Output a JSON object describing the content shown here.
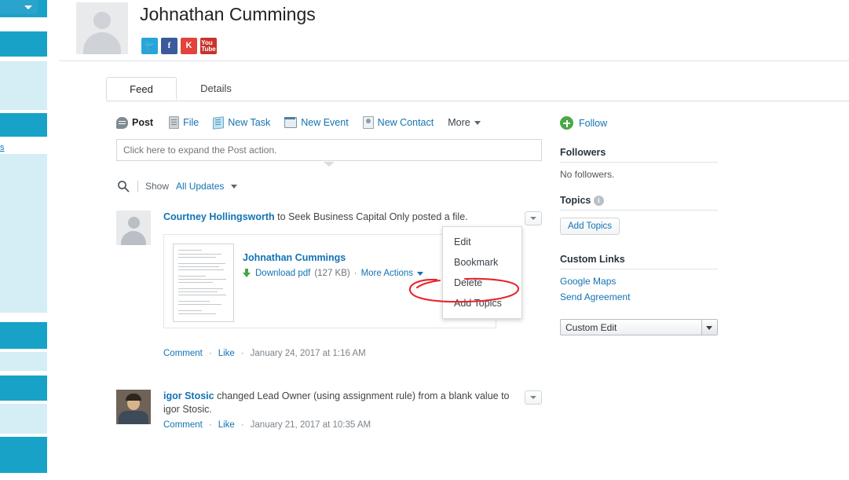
{
  "left_nav": {
    "dropdown_icon": "caret-down-icon",
    "collapse_icon": "collapse-left-icon",
    "truncated_link": "s",
    "strip_color_dark": "#19a2c8",
    "strip_color_light": "#d5edf5"
  },
  "profile": {
    "name": "Johnathan Cummings",
    "avatar_icon": "user-placeholder-avatar",
    "social": [
      {
        "name": "twitter-icon",
        "glyph": "t"
      },
      {
        "name": "facebook-icon",
        "glyph": "f"
      },
      {
        "name": "klout-icon",
        "glyph": "K"
      },
      {
        "name": "youtube-icon",
        "glyph": "You\nTube"
      }
    ]
  },
  "tabs": [
    {
      "label": "Feed",
      "active": true
    },
    {
      "label": "Details",
      "active": false
    }
  ],
  "actions": [
    {
      "label": "Post",
      "icon": "post-bubble-icon",
      "selected": true
    },
    {
      "label": "File",
      "icon": "file-icon",
      "selected": false
    },
    {
      "label": "New Task",
      "icon": "task-icon",
      "selected": false
    },
    {
      "label": "New Event",
      "icon": "event-calendar-icon",
      "selected": false
    },
    {
      "label": "New Contact",
      "icon": "contact-card-icon",
      "selected": false
    },
    {
      "label": "More",
      "icon": "caret-down-icon",
      "selected": false
    }
  ],
  "publisher": {
    "placeholder": "Click here to expand the Post action.",
    "value": ""
  },
  "feed_filter": {
    "search_icon": "magnifier-icon",
    "show_label": "Show",
    "show_value": "All Updates",
    "caret_icon": "caret-down-icon"
  },
  "feed": [
    {
      "author": "Courtney Hollingsworth",
      "text_rest": " to Seek Business Capital Only posted a file.",
      "menu_icon": "caret-down-icon",
      "attachment": {
        "title": "Johnathan Cummings",
        "download_label": "Download pdf",
        "size": "(127 KB)",
        "separator": "·",
        "more_actions": "More Actions",
        "more_caret": "caret-down-icon",
        "thumb_icon": "pdf-thumbnail-preview"
      },
      "comment": "Comment",
      "like": "Like",
      "dot": "·",
      "timestamp": "January 24, 2017 at 1:16 AM"
    },
    {
      "author": "igor Stosic",
      "text_rest": " changed Lead Owner (using assignment rule) from a blank value to igor Stosic.",
      "menu_icon": "caret-down-icon",
      "comment": "Comment",
      "like": "Like",
      "dot": "·",
      "timestamp": "January 21, 2017 at 10:35 AM"
    }
  ],
  "open_menu": {
    "items": [
      "Edit",
      "Bookmark",
      "Delete",
      "Add Topics"
    ],
    "highlighted": "Delete",
    "annotation_color": "#e8232a"
  },
  "right_column": {
    "follow_label": "Follow",
    "follow_icon": "plus-circle-icon",
    "followers_title": "Followers",
    "followers_empty": "No followers.",
    "topics_title": "Topics",
    "topics_info_icon": "info-icon",
    "add_topics_button": "Add Topics",
    "custom_links_title": "Custom Links",
    "custom_links": [
      "Google Maps",
      "Send Agreement"
    ],
    "custom_edit_value": "Custom Edit",
    "custom_edit_caret": "caret-down-icon"
  }
}
